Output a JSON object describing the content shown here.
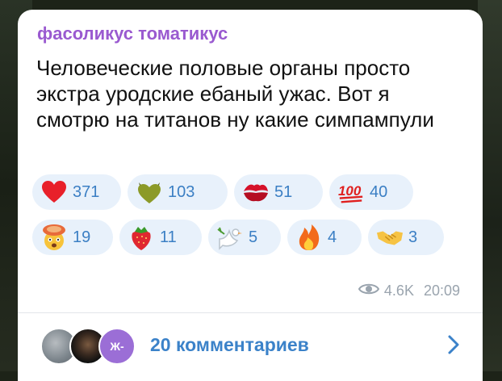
{
  "post": {
    "author": "фасоликус томатикус",
    "text": "Человеческие половые органы просто экстра уродские ебаный ужас. Вот я смотрю на титанов ну какие симпампули"
  },
  "reactions": {
    "row1": [
      {
        "icon": "red-heart-icon",
        "count": "371"
      },
      {
        "icon": "green-heart-horns-icon",
        "count": "103"
      },
      {
        "icon": "kiss-mark-icon",
        "count": "51"
      },
      {
        "icon": "hundred-points-icon",
        "count": "40"
      }
    ],
    "row2": [
      {
        "icon": "exploding-head-icon",
        "count": "19"
      },
      {
        "icon": "strawberry-icon",
        "count": "11"
      },
      {
        "icon": "dove-icon",
        "count": "5"
      },
      {
        "icon": "fire-icon",
        "count": "4"
      },
      {
        "icon": "handshake-icon",
        "count": "3"
      }
    ]
  },
  "meta": {
    "views": "4.6K",
    "time": "20:09"
  },
  "comments": {
    "label": "20 комментариев",
    "avatar3_text": "Ж-"
  },
  "colors": {
    "author": "#9a5ad0",
    "accent": "#3b82c9",
    "reaction_bg": "#e8f1fb"
  }
}
